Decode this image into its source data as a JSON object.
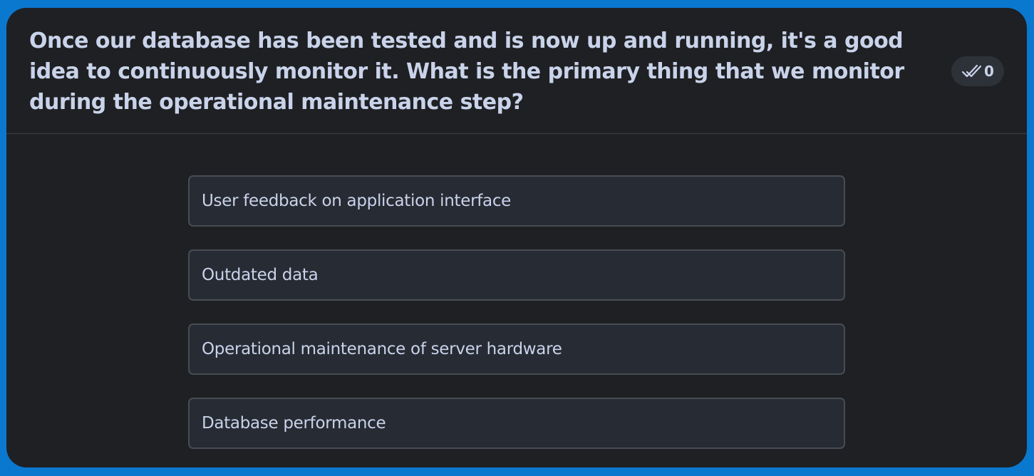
{
  "question": {
    "text": "Once our database has been tested and is now up and running, it's a good idea to continuously monitor it. What is the primary thing that we monitor during the operational maintenance step?"
  },
  "badge": {
    "icon": "double-check-icon",
    "count": "0"
  },
  "options": [
    {
      "label": "User feedback on application interface"
    },
    {
      "label": "Outdated data"
    },
    {
      "label": "Operational maintenance of server hardware"
    },
    {
      "label": "Database performance"
    }
  ],
  "colors": {
    "page_background": "#0b78d0",
    "card_background": "#1f2023",
    "option_background": "#272b33",
    "option_border": "#474c55",
    "text": "#c9d3ea"
  }
}
